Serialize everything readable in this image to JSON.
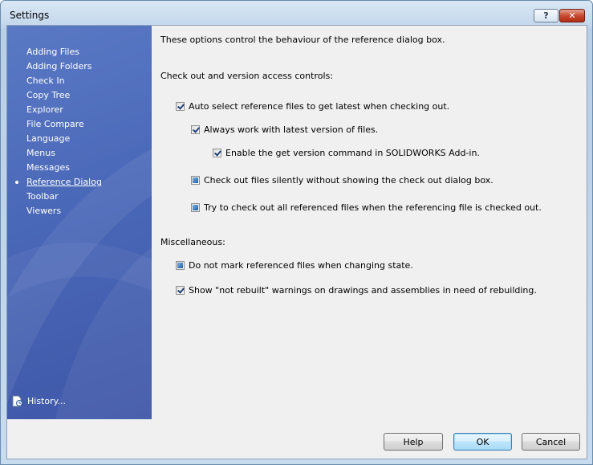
{
  "window": {
    "title": "Settings",
    "help_label": "?",
    "close_label": "✕"
  },
  "sidebar": {
    "items": [
      {
        "label": "Adding Files",
        "selected": false
      },
      {
        "label": "Adding Folders",
        "selected": false
      },
      {
        "label": "Check In",
        "selected": false
      },
      {
        "label": "Copy Tree",
        "selected": false
      },
      {
        "label": "Explorer",
        "selected": false
      },
      {
        "label": "File Compare",
        "selected": false
      },
      {
        "label": "Language",
        "selected": false
      },
      {
        "label": "Menus",
        "selected": false
      },
      {
        "label": "Messages",
        "selected": false
      },
      {
        "label": "Reference Dialog",
        "selected": true
      },
      {
        "label": "Toolbar",
        "selected": false
      },
      {
        "label": "Viewers",
        "selected": false
      }
    ],
    "history_label": "History..."
  },
  "content": {
    "description": "These options control the behaviour of the reference dialog box.",
    "section1_title": "Check out and version access controls:",
    "options1": [
      {
        "label": "Auto select reference files to get latest when checking out.",
        "state": "checked"
      },
      {
        "label": "Always work with latest version of files.",
        "state": "checked"
      },
      {
        "label": "Enable the get version command in SOLIDWORKS Add-in.",
        "state": "checked"
      },
      {
        "label": "Check out files silently without showing the check out dialog box.",
        "state": "indeterminate"
      },
      {
        "label": "Try to check out all referenced files when the referencing file is checked out.",
        "state": "indeterminate"
      }
    ],
    "section2_title": "Miscellaneous:",
    "options2": [
      {
        "label": "Do not mark referenced files when changing state.",
        "state": "indeterminate"
      },
      {
        "label": "Show \"not rebuilt\" warnings on drawings and assemblies in need of rebuilding.",
        "state": "checked"
      }
    ]
  },
  "footer": {
    "help_label": "Help",
    "ok_label": "OK",
    "cancel_label": "Cancel"
  }
}
